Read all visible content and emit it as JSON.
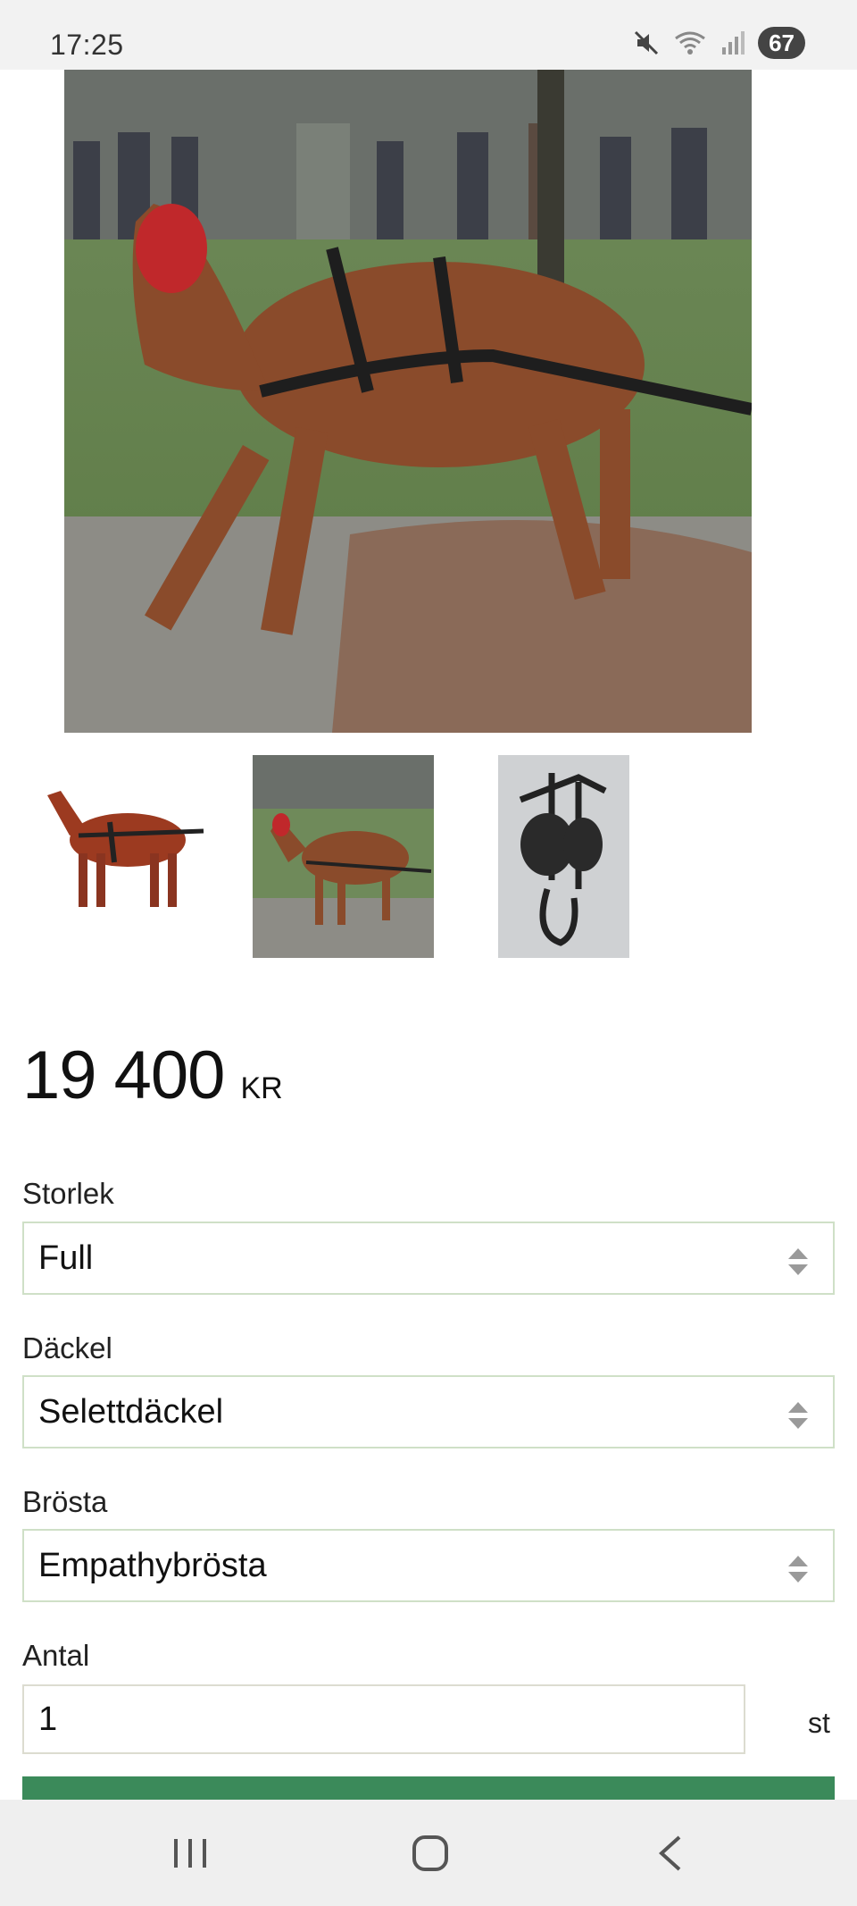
{
  "status_bar": {
    "time": "17:25",
    "battery": "67",
    "icons": [
      "mute-icon",
      "wifi-icon",
      "signal-icon",
      "battery-icon"
    ]
  },
  "product": {
    "main_image": "horse-in-harness-photo",
    "thumbnails": [
      "horse-harness-studio-photo",
      "horse-in-harness-photo",
      "harness-breastplate-photo"
    ],
    "price_amount": "19 400",
    "price_currency": "KR"
  },
  "form": {
    "size_label": "Storlek",
    "size_value": "Full",
    "saddle_label": "Däckel",
    "saddle_value": "Selettdäckel",
    "breast_label": "Brösta",
    "breast_value": "Empathybrösta",
    "qty_label": "Antal",
    "qty_value": "1",
    "qty_unit": "st"
  },
  "colors": {
    "accent": "#3b8a5a",
    "field_border": "#cfe0c7"
  },
  "nav": {
    "icons": [
      "recent-apps-icon",
      "home-icon",
      "back-icon"
    ]
  }
}
